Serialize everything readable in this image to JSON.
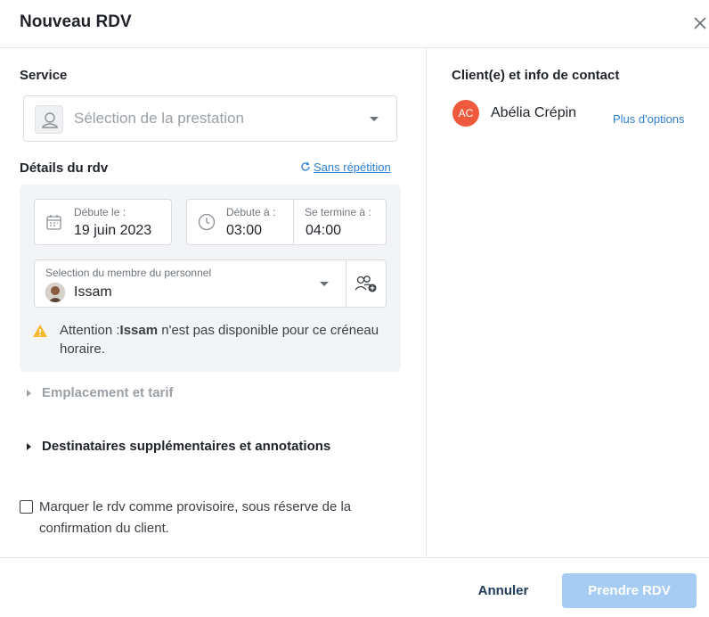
{
  "dialog": {
    "title": "Nouveau RDV",
    "close_icon": "close-icon"
  },
  "service": {
    "section_label": "Service",
    "placeholder": "Sélection de la prestation",
    "icon": "service-icon"
  },
  "details": {
    "section_label": "Détails du rdv",
    "repeat_link": "Sans répétition",
    "start_date": {
      "label": "Débute le :",
      "value": "19 juin 2023",
      "icon": "calendar-icon"
    },
    "start_time": {
      "label": "Débute à :",
      "value": "03:00",
      "icon": "clock-icon"
    },
    "end_time": {
      "label": "Se termine à :",
      "value": "04:00"
    },
    "staff": {
      "label": "Selection du membre du personnel",
      "value": "Issam",
      "add_icon": "add-staff-icon"
    },
    "warning": {
      "prefix": "Attention :",
      "name": "Issam",
      "suffix": " n'est pas disponible pour ce créneau horaire."
    }
  },
  "sections": {
    "location_pricing": "Emplacement et tarif",
    "recipients": "Destinataires supplémentaires et annotations"
  },
  "provisional": {
    "checked": false,
    "label": "Marquer le rdv comme provisoire, sous réserve de la confirmation du client."
  },
  "client": {
    "section_label": "Client(e) et info de contact",
    "initials": "AC",
    "name": "Abélia Crépin",
    "more_options": "Plus d'options",
    "avatar_color": "#ef5a3c"
  },
  "footer": {
    "cancel_label": "Annuler",
    "submit_label": "Prendre RDV",
    "submit_color": "#a6ccf4"
  }
}
